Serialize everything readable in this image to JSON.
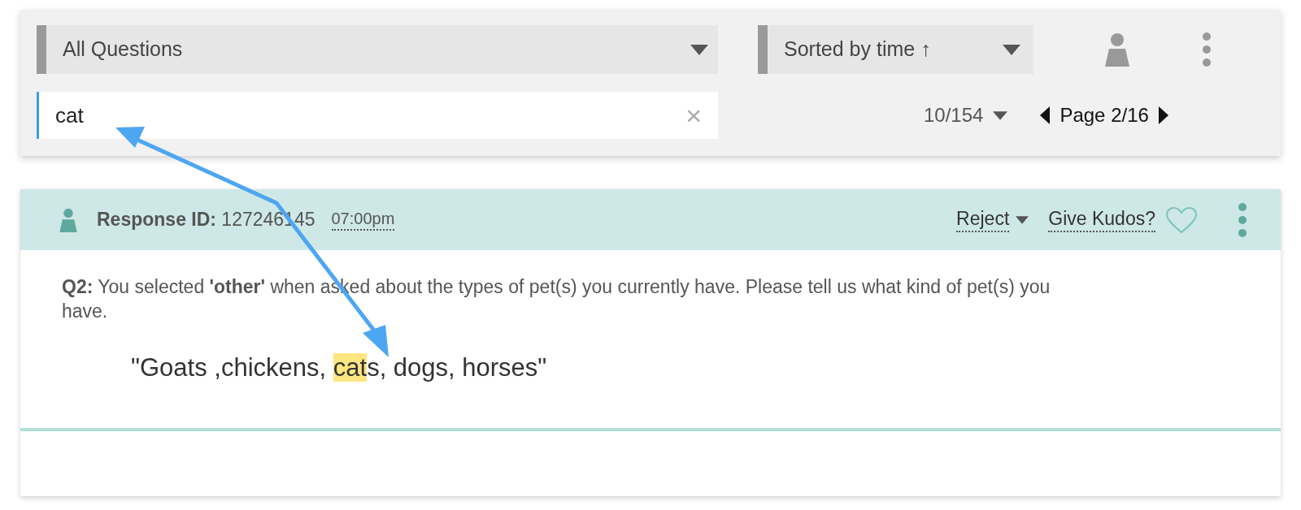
{
  "filters": {
    "question_select": {
      "value": "All Questions"
    },
    "sort_select": {
      "value": "Sorted by time ↑"
    }
  },
  "search": {
    "value": "cat",
    "clear": "×"
  },
  "pagination": {
    "per_page": "10/154",
    "page": "Page 2/16"
  },
  "responses": [
    {
      "id_label": "Response ID:",
      "id": "127246145",
      "time": "07:00pm",
      "action": "Reject",
      "kudos": "Give Kudos?",
      "kudos_given": false,
      "question": "**Q2:** You selected **'other'** when asked about the types of pet(s) you currently have. Please tell us what kind of pet(s) you have.",
      "answer": [
        {
          "text": "\"Goats ,chickens, ",
          "highlighted": false
        },
        {
          "text": "cat",
          "highlighted": true
        },
        {
          "text": "s, dogs, horses\"",
          "highlighted": false
        }
      ]
    }
  ]
}
